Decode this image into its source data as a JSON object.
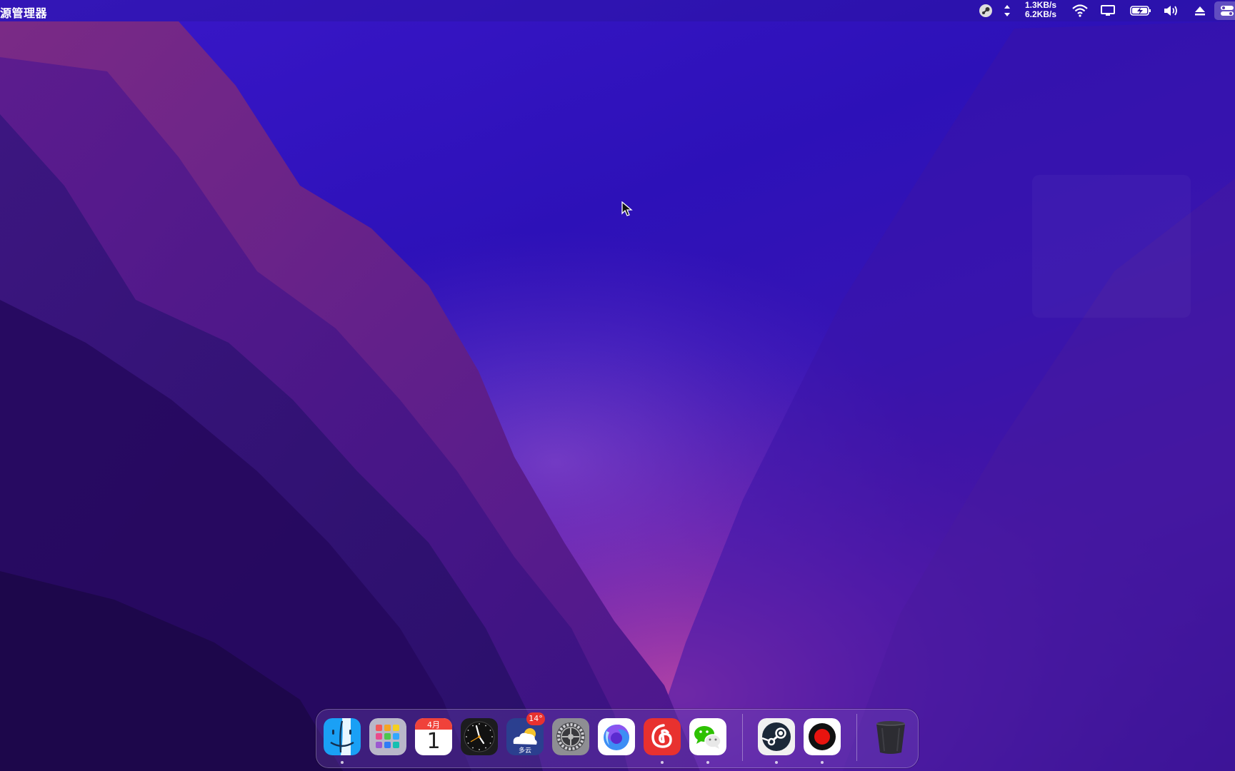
{
  "menubar": {
    "app_name": "源管理器",
    "net_up": "1.3KB/s",
    "net_down": "6.2KB/s"
  },
  "dock": {
    "apps": [
      {
        "name": "Finder",
        "icon": "finder-icon",
        "running": true
      },
      {
        "name": "Launchpad",
        "icon": "launchpad-icon",
        "running": false
      },
      {
        "name": "Calendar",
        "icon": "calendar-icon",
        "running": false,
        "month": "4月",
        "day": "1"
      },
      {
        "name": "Clock",
        "icon": "clock-icon",
        "running": false
      },
      {
        "name": "Weather",
        "icon": "weather-icon",
        "running": false,
        "temp": "14°",
        "condition": "多云"
      },
      {
        "name": "System Settings",
        "icon": "gear-icon",
        "running": false
      },
      {
        "name": "Firefox",
        "icon": "firefox-icon",
        "running": false
      },
      {
        "name": "NetEase Cloud Music",
        "icon": "netease-music-icon",
        "running": true
      },
      {
        "name": "WeChat",
        "icon": "wechat-icon",
        "running": true
      },
      {
        "name": "Steam",
        "icon": "steam-icon",
        "running": true
      },
      {
        "name": "Screen Recorder",
        "icon": "record-icon",
        "running": true
      },
      {
        "name": "Trash",
        "icon": "trash-icon",
        "running": false
      }
    ]
  },
  "colors": {
    "accent_red": "#e8312f",
    "calendar_red": "#f0423a"
  }
}
